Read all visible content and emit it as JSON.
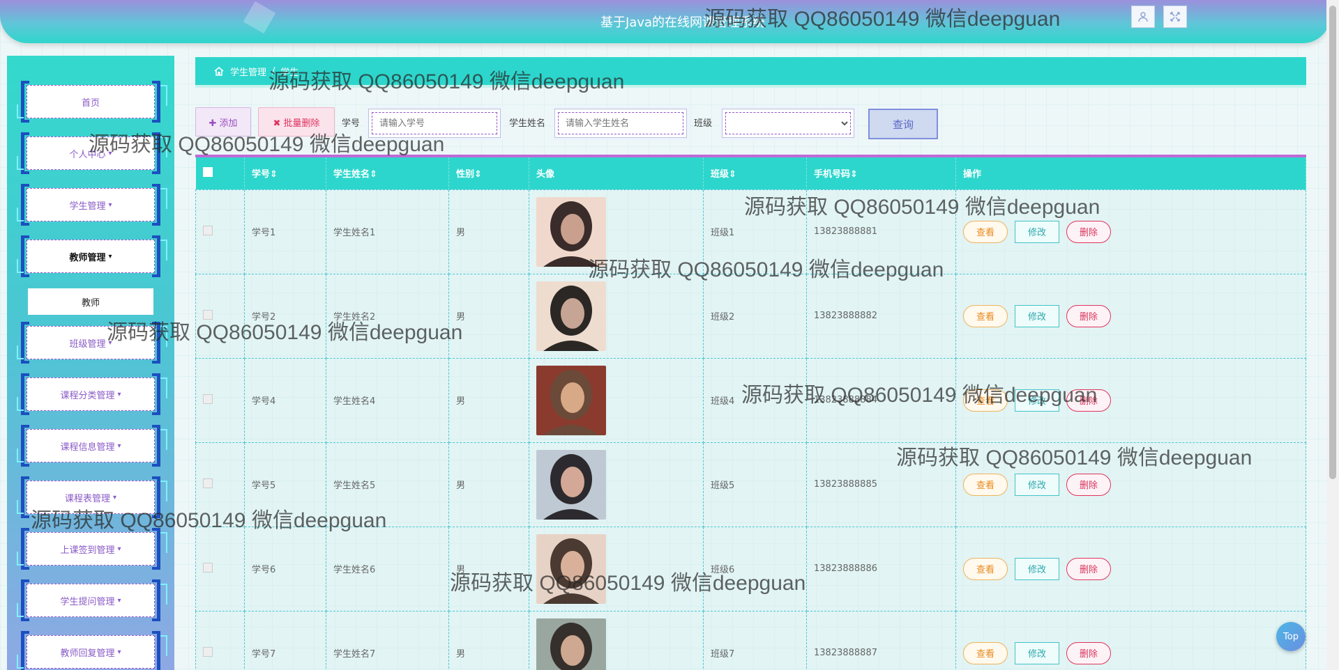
{
  "app": {
    "title": "基于Java的在线网课管理系统"
  },
  "header": {
    "user_icon": "user-icon",
    "fullscreen_icon": "fullscreen-icon"
  },
  "sidebar": {
    "items": [
      {
        "label": "首页",
        "caret": ""
      },
      {
        "label": "个人中心",
        "caret": "▾"
      },
      {
        "label": "学生管理",
        "caret": "▾"
      },
      {
        "label": "教师管理",
        "caret": "▾"
      },
      {
        "label": "班级管理",
        "caret": "▾"
      },
      {
        "label": "课程分类管理",
        "caret": "▾"
      },
      {
        "label": "课程信息管理",
        "caret": "▾"
      },
      {
        "label": "课程表管理",
        "caret": "▾"
      },
      {
        "label": "上课签到管理",
        "caret": "▾"
      },
      {
        "label": "学生提问管理",
        "caret": "▾"
      },
      {
        "label": "教师回复管理",
        "caret": "▾"
      }
    ],
    "subitem": "教师"
  },
  "breadcrumb": {
    "home_icon": "home-icon",
    "level1": "学生管理",
    "sep": "/",
    "level2": "学生"
  },
  "toolbar": {
    "add_label": "✚ 添加",
    "batch_delete_label": "✖ 批量删除",
    "student_no_label": "学号",
    "student_no_placeholder": "请输入学号",
    "student_name_label": "学生姓名",
    "student_name_placeholder": "请输入学生姓名",
    "class_label": "班级",
    "class_value": "",
    "search_label": "查询"
  },
  "table": {
    "columns": [
      "学号⇕",
      "学生姓名⇕",
      "性别⇕",
      "头像",
      "班级⇕",
      "手机号码⇕",
      "操作"
    ],
    "rows": [
      {
        "no": "学号1",
        "name": "学生姓名1",
        "gender": "男",
        "class": "班级1",
        "phone": "13823888881"
      },
      {
        "no": "学号2",
        "name": "学生姓名2",
        "gender": "男",
        "class": "班级2",
        "phone": "13823888882"
      },
      {
        "no": "学号4",
        "name": "学生姓名4",
        "gender": "男",
        "class": "班级4",
        "phone": "13823888884"
      },
      {
        "no": "学号5",
        "name": "学生姓名5",
        "gender": "男",
        "class": "班级5",
        "phone": "13823888885"
      },
      {
        "no": "学号6",
        "name": "学生姓名6",
        "gender": "男",
        "class": "班级6",
        "phone": "13823888886"
      },
      {
        "no": "学号7",
        "name": "学生姓名7",
        "gender": "男",
        "class": "班级7",
        "phone": "13823888887"
      }
    ],
    "actions": {
      "view": "查看",
      "edit": "修改",
      "delete": "删除"
    }
  },
  "watermark": "源码获取 QQ86050149 微信deepguan",
  "top_button": "Top"
}
